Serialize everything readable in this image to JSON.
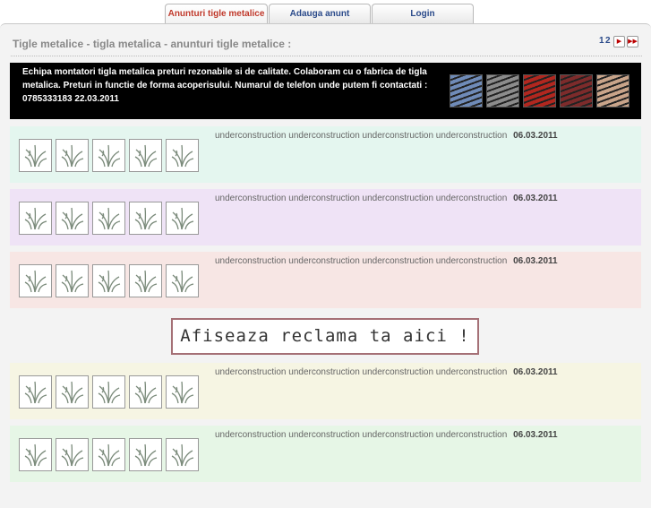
{
  "tabs": [
    {
      "label": "Anunturi tigle metalice",
      "active": true
    },
    {
      "label": "Adauga anunt",
      "active": false
    },
    {
      "label": "Login",
      "active": false
    }
  ],
  "page_title": "Tigle metalice - tigla metalica - anunturi tigle metalice :",
  "pager": {
    "pages": [
      "1",
      "2"
    ],
    "next_icon": "arrow-right-icon",
    "last_icon": "double-arrow-right-icon"
  },
  "banner": {
    "text": "Echipa montatori tigla metalica preturi rezonabile si de calitate. Colaboram cu o fabrica de tigla metalica. Preturi in functie de forma acoperisului. Numarul de telefon unde putem fi contactati : 0785333183  22.03.2011",
    "thumbnails": [
      "roof-photo-blue",
      "roof-photo-gray",
      "roof-photo-red",
      "roof-photo-wine",
      "roof-photo-site"
    ],
    "thumb_colors": [
      "#6f8bb8",
      "#8c8c8c",
      "#b2271f",
      "#7d2b2b",
      "#c9a48a"
    ]
  },
  "listings": [
    {
      "text": "underconstruction underconstruction underconstruction underconstruction",
      "date": "06.03.2011",
      "bg": "#e4f6ef"
    },
    {
      "text": "underconstruction underconstruction underconstruction underconstruction",
      "date": "06.03.2011",
      "bg": "#efe3f6"
    },
    {
      "text": "underconstruction underconstruction underconstruction underconstruction",
      "date": "06.03.2011",
      "bg": "#f7e6e4"
    },
    {
      "text": "underconstruction underconstruction underconstruction underconstruction",
      "date": "06.03.2011",
      "bg": "#f6f5e3"
    },
    {
      "text": "underconstruction underconstruction underconstruction underconstruction",
      "date": "06.03.2011",
      "bg": "#e6f6e6"
    }
  ],
  "placeholder_icon": "grass-placeholder-icon",
  "promo": {
    "label": "Afiseaza reclama ta aici !"
  }
}
